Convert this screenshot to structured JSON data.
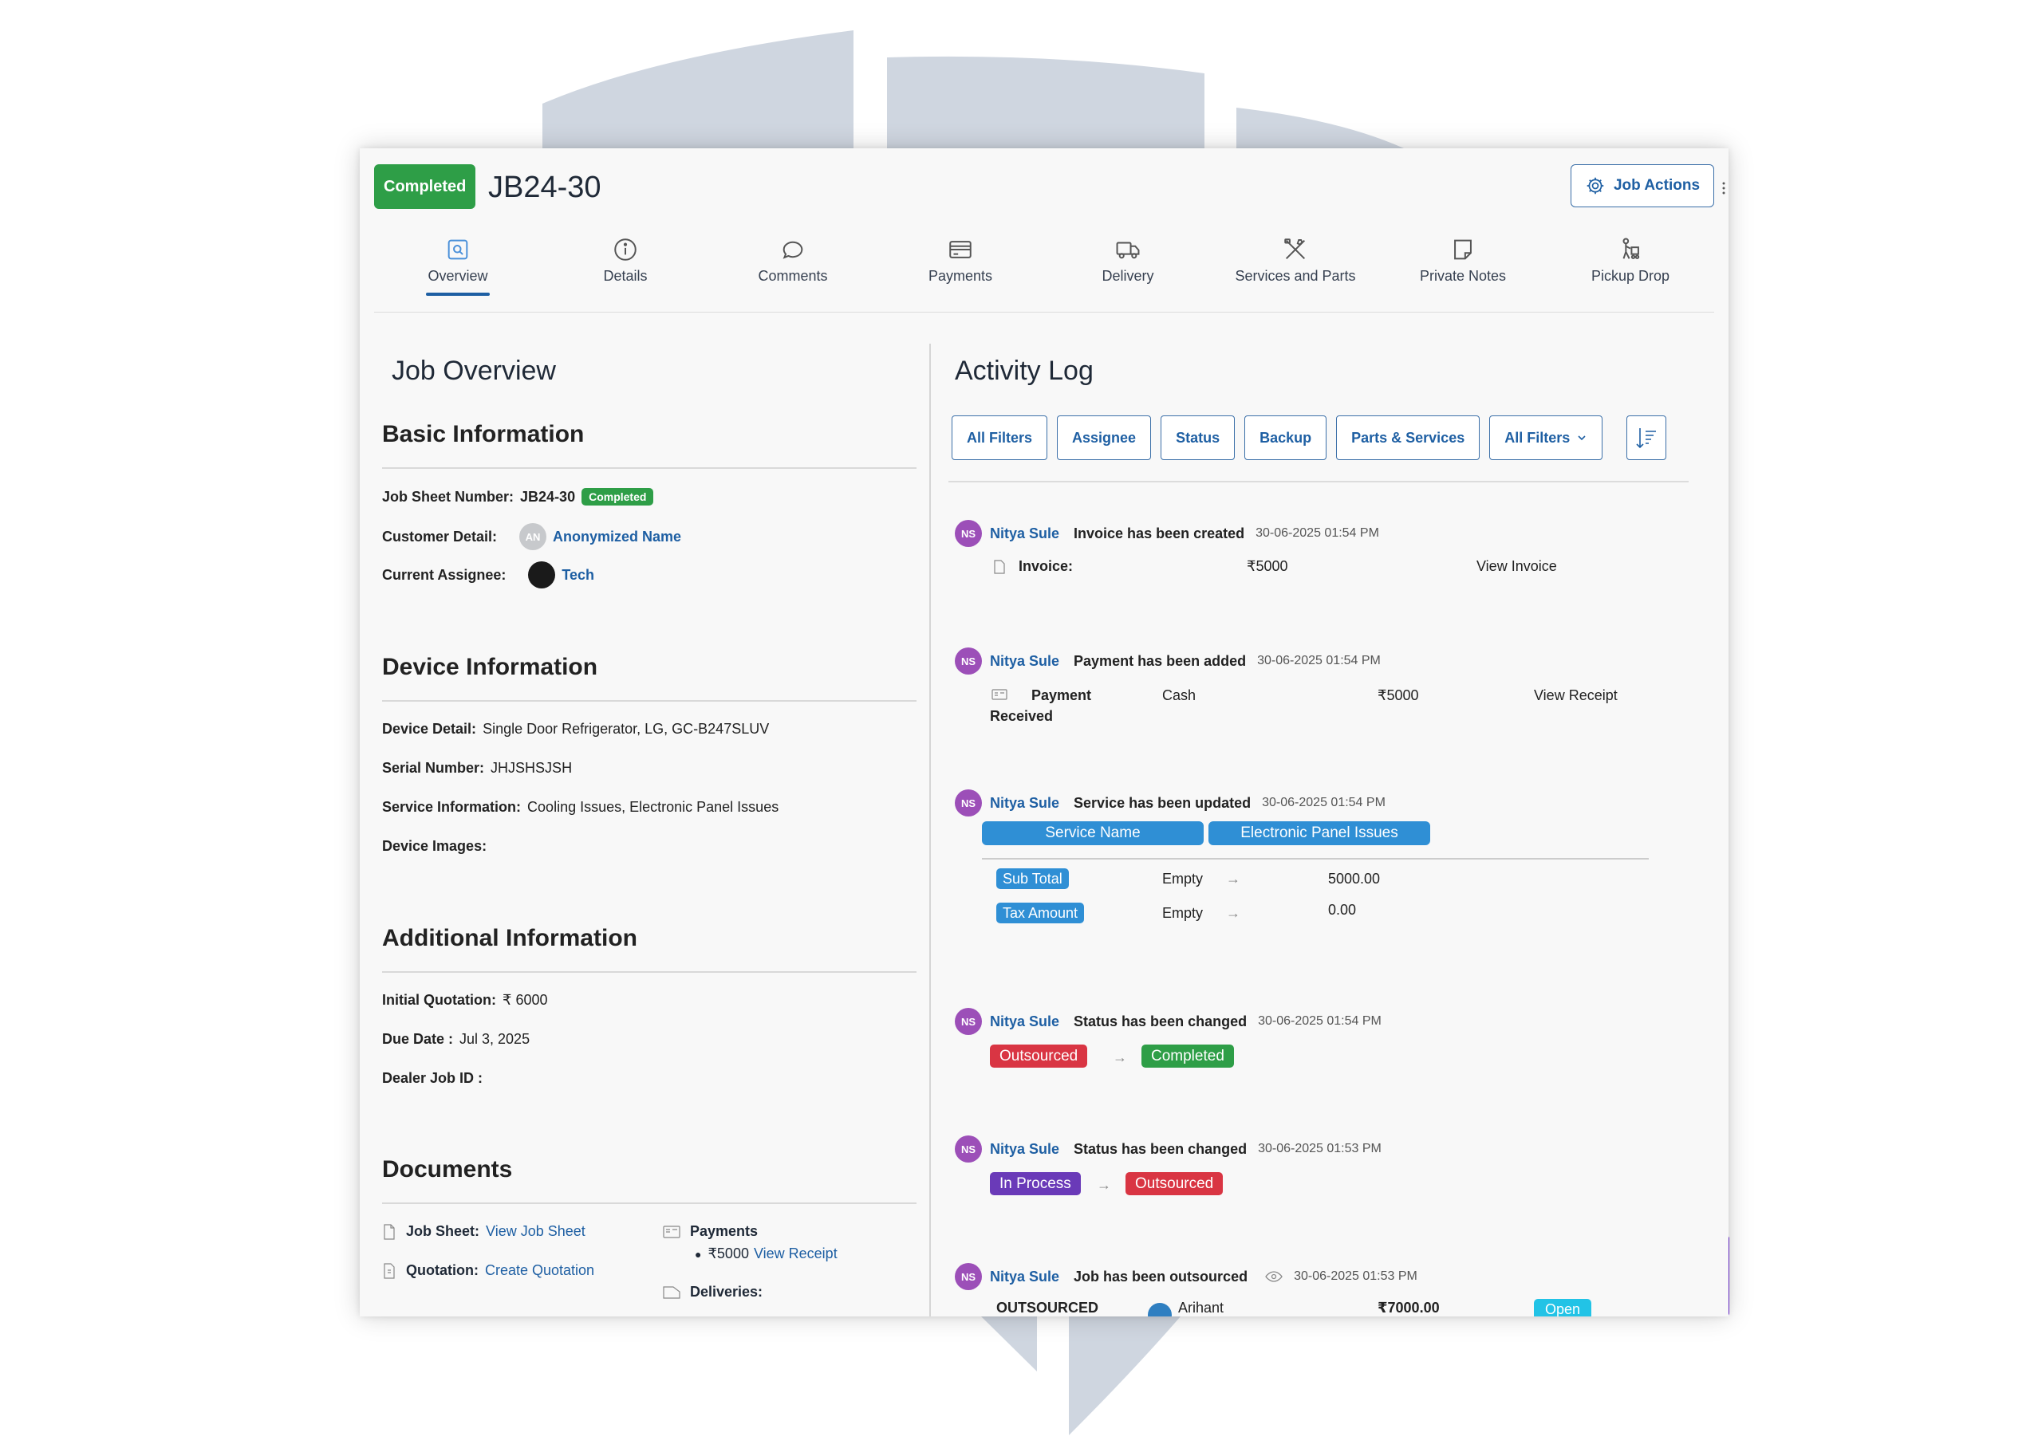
{
  "header": {
    "status": "Completed",
    "job_id": "JB24-30",
    "actions_label": "Job Actions"
  },
  "tabs": [
    {
      "label": "Overview",
      "icon": "search-doc-icon",
      "active": true
    },
    {
      "label": "Details",
      "icon": "info-icon"
    },
    {
      "label": "Comments",
      "icon": "chat-icon"
    },
    {
      "label": "Payments",
      "icon": "card-icon"
    },
    {
      "label": "Delivery",
      "icon": "truck-icon"
    },
    {
      "label": "Services and Parts",
      "icon": "tools-icon"
    },
    {
      "label": "Private Notes",
      "icon": "note-icon"
    },
    {
      "label": "Pickup Drop",
      "icon": "person-cart-icon"
    }
  ],
  "overview": {
    "title": "Job Overview",
    "basic": {
      "title": "Basic Information",
      "job_sheet_label": "Job Sheet Number:",
      "job_sheet_value": "JB24-30",
      "job_sheet_badge": "Completed",
      "customer_label": "Customer Detail:",
      "customer_initials": "AN",
      "customer_name": "Anonymized Name",
      "assignee_label": "Current Assignee:",
      "assignee_name": "Tech"
    },
    "device": {
      "title": "Device Information",
      "detail_label": "Device Detail:",
      "detail_value": "Single Door Refrigerator, LG, GC-B247SLUV",
      "serial_label": "Serial Number:",
      "serial_value": "JHJSHSJSH",
      "service_label": "Service Information:",
      "service_value": "Cooling Issues, Electronic Panel Issues",
      "images_label": "Device Images:"
    },
    "additional": {
      "title": "Additional Information",
      "quotation_label": "Initial Quotation:",
      "quotation_value": "₹ 6000",
      "due_label": "Due Date :",
      "due_value": "Jul 3, 2025",
      "dealer_label": "Dealer Job ID :"
    },
    "documents": {
      "title": "Documents",
      "job_sheet_label": "Job Sheet:",
      "job_sheet_link": "View Job Sheet",
      "quotation_label": "Quotation:",
      "quotation_link": "Create Quotation",
      "payments_label": "Payments",
      "payment_item_amount": "₹5000",
      "payment_item_link": "View Receipt",
      "deliveries_label": "Deliveries:"
    }
  },
  "activity": {
    "title": "Activity Log",
    "filters": [
      "All Filters",
      "Assignee",
      "Status",
      "Backup",
      "Parts & Services"
    ],
    "filter_dropdown": "All Filters",
    "entries": [
      {
        "initials": "NS",
        "actor": "Nitya Sule",
        "message": "Invoice has been created",
        "time": "30-06-2025 01:54 PM",
        "label": "Invoice:",
        "amount": "₹5000",
        "link": "View Invoice"
      },
      {
        "initials": "NS",
        "actor": "Nitya Sule",
        "message": "Payment has been added",
        "time": "30-06-2025 01:54 PM",
        "label_line1": "Payment",
        "label_line2": "Received",
        "method": "Cash",
        "amount": "₹5000",
        "link": "View Receipt"
      },
      {
        "initials": "NS",
        "actor": "Nitya Sule",
        "message": "Service has been updated",
        "time": "30-06-2025 01:54 PM",
        "service_header": "Service Name",
        "service_value": "Electronic Panel Issues",
        "rows": [
          {
            "label": "Sub Total",
            "from": "Empty",
            "to": "5000.00"
          },
          {
            "label": "Tax Amount",
            "from": "Empty",
            "to": "0.00"
          }
        ]
      },
      {
        "initials": "NS",
        "actor": "Nitya Sule",
        "message": "Status has been changed",
        "time": "30-06-2025 01:54 PM",
        "from": "Outsourced",
        "to": "Completed"
      },
      {
        "initials": "NS",
        "actor": "Nitya Sule",
        "message": "Status has been changed",
        "time": "30-06-2025 01:53 PM",
        "from": "In Process",
        "to": "Outsourced"
      },
      {
        "initials": "NS",
        "actor": "Nitya Sule",
        "message": "Job has been outsourced",
        "time": "30-06-2025 01:53 PM",
        "label": "OUTSOURCED",
        "vendor": "Arihant",
        "amount": "₹7000.00",
        "status": "Open"
      }
    ]
  },
  "colors": {
    "green": "#2e9e47",
    "blue": "#1e5fa3",
    "red": "#d93543",
    "purple": "#6a3ab8",
    "cyan": "#22c3e6",
    "avatar": "#9c4fb8"
  }
}
